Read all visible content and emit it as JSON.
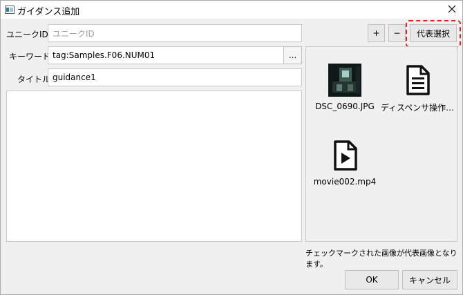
{
  "window": {
    "title": "ガイダンス追加"
  },
  "form": {
    "unique_id_label": "ユニークID:",
    "unique_id_value": "",
    "unique_id_placeholder": "ユニークID",
    "keyword_label": "キーワード:",
    "keyword_value": "tag:Samples.F06.NUM01",
    "browse_label": "...",
    "title_label": "タイトル:",
    "title_value": "guidance1",
    "body_value": ""
  },
  "attachments": {
    "add_label": "+",
    "remove_label": "−",
    "select_rep_label": "代表選択",
    "items": [
      {
        "name": "DSC_0690.JPG",
        "icon": "image-thumbnail"
      },
      {
        "name": "ディスペンサ操作…",
        "icon": "document-icon"
      },
      {
        "name": "movie002.mp4",
        "icon": "video-file-icon"
      }
    ],
    "hint": "チェックマークされた画像が代表画像となります。"
  },
  "footer": {
    "ok_label": "OK",
    "cancel_label": "キャンセル"
  },
  "colors": {
    "highlight": "#e02020",
    "icon_dark": "#111111"
  }
}
